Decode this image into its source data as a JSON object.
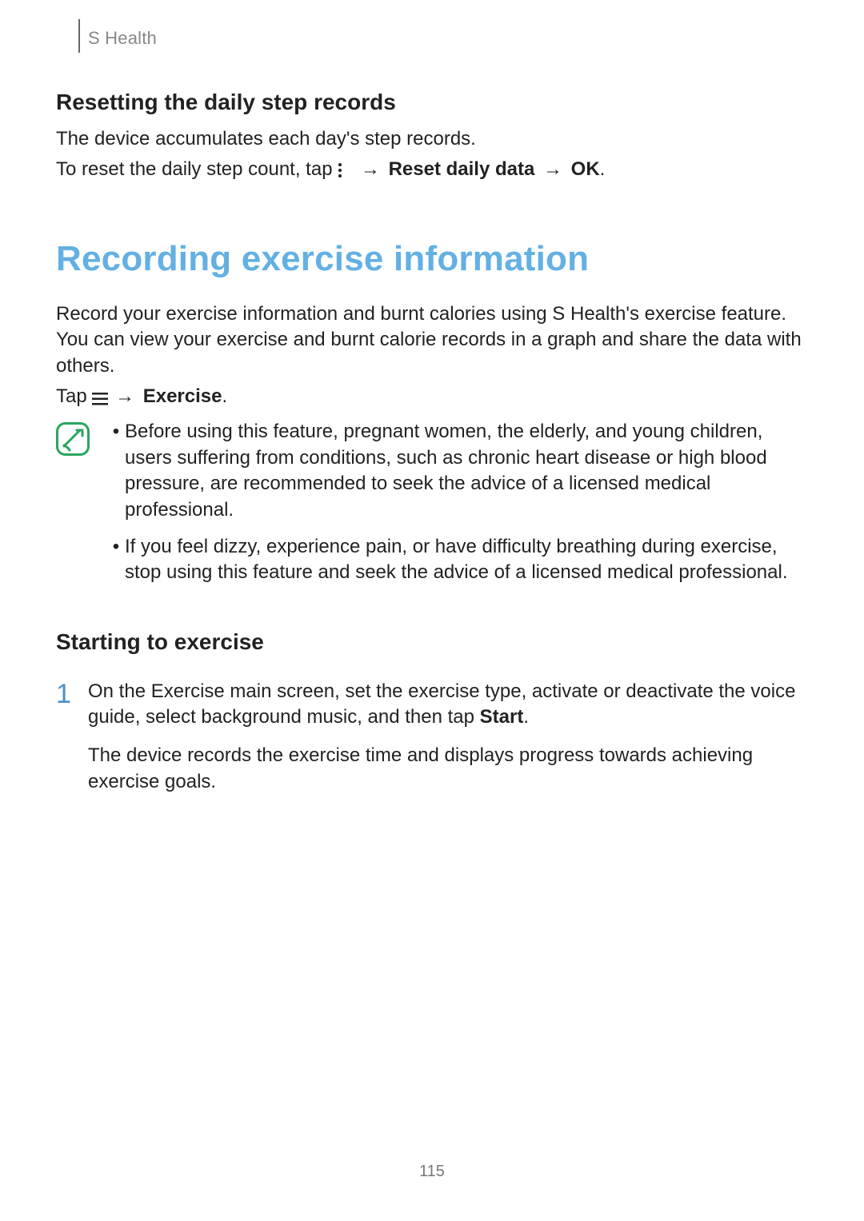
{
  "header": {
    "section": "S Health"
  },
  "sections": {
    "reset": {
      "heading": "Resetting the daily step records",
      "p1": "The device accumulates each day's step records.",
      "line_prefix": "To reset the daily step count, tap ",
      "arrow": "→",
      "bold1": "Reset daily data",
      "bold2": "OK",
      "period": "."
    },
    "recording": {
      "h1": "Recording exercise information",
      "p1": "Record your exercise information and burnt calories using S Health's exercise feature. You can view your exercise and burnt calorie records in a graph and share the data with others.",
      "tap_prefix": "Tap ",
      "arrow": "→",
      "exercise_bold": "Exercise",
      "period": "."
    },
    "notes": {
      "bullets": [
        "Before using this feature, pregnant women, the elderly, and young children, users suffering from conditions, such as chronic heart disease or high blood pressure, are recommended to seek the advice of a licensed medical professional.",
        "If you feel dizzy, experience pain, or have difficulty breathing during exercise, stop using this feature and seek the advice of a licensed medical professional."
      ]
    },
    "starting": {
      "heading": "Starting to exercise",
      "steps": [
        {
          "num": "1",
          "p1_pre": "On the Exercise main screen, set the exercise type, activate or deactivate the voice guide, select background music, and then tap ",
          "p1_bold": "Start",
          "p1_post": ".",
          "p2": "The device records the exercise time and displays progress towards achieving exercise goals."
        }
      ]
    }
  },
  "icons": {
    "bullet": "•"
  },
  "pageNumber": "115"
}
